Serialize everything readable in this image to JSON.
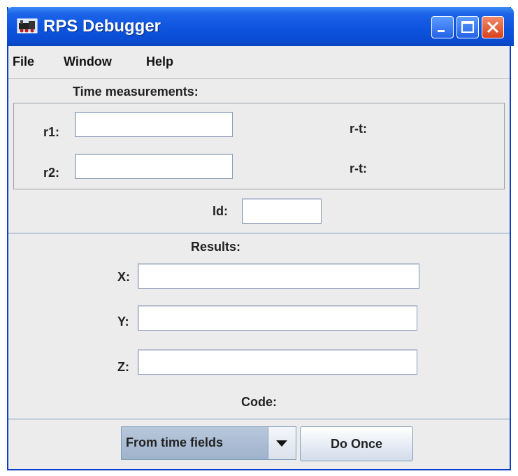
{
  "window": {
    "title": "RPS Debugger"
  },
  "menu": {
    "items": [
      "File",
      "Window",
      "Help"
    ]
  },
  "time_measurements": {
    "heading": "Time measurements:",
    "r1_label": "r1:",
    "r1_value": "",
    "r1_rt_label": "r-t:",
    "r2_label": "r2:",
    "r2_value": "",
    "r2_rt_label": "r-t:"
  },
  "id_section": {
    "label": "Id:",
    "value": ""
  },
  "results": {
    "heading": "Results:",
    "x_label": "X:",
    "x_value": "",
    "y_label": "Y:",
    "y_value": "",
    "z_label": "Z:",
    "z_value": "",
    "code_label": "Code:"
  },
  "controls": {
    "source_selected": "From time fields",
    "do_once_label": "Do Once"
  },
  "colors": {
    "titlebar": "#0a4cd2",
    "window_bg": "#ececec",
    "close_button": "#d8421c"
  },
  "icons": {
    "app": "train-icon",
    "minimize": "minimize-icon",
    "maximize": "maximize-icon",
    "close": "close-icon",
    "dropdown": "chevron-down-icon"
  }
}
